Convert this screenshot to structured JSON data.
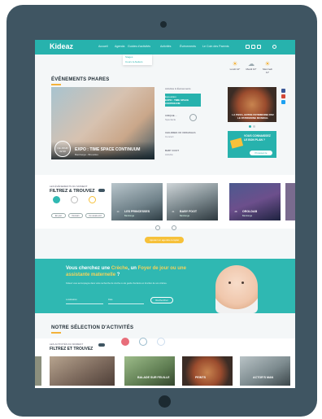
{
  "header": {
    "logo": "Kideaz",
    "nav": [
      {
        "label": "Accueil"
      },
      {
        "label": "Agenda"
      },
      {
        "label": "Guides d'activités"
      },
      {
        "label": "Activités"
      },
      {
        "label": "Événements"
      },
      {
        "label": "Le Coin des Parents"
      }
    ],
    "dropdown": [
      "Stages",
      "Cours & Ateliers"
    ]
  },
  "weather": [
    {
      "day": "Lundi",
      "temp": "12°"
    },
    {
      "day": "Mardi",
      "temp": "10°"
    },
    {
      "day": "Mercredi",
      "temp": "11°"
    }
  ],
  "events": {
    "title": "ÉVÉNEMENTS PHARES",
    "hero": {
      "badge_line1": "CE JOUR",
      "badge_line2": "22:30",
      "title": "EXPO : TIME SPACE CONTINUUM",
      "subtitle": "Bamberga - Bruxelles"
    },
    "list_header": "Activités & Événements",
    "items": [
      {
        "label": "EXPO : TIME SPACE CONTINUUM",
        "sub": "Exposition"
      },
      {
        "label": "CIRQUE ... ",
        "sub": "Spectacle"
      },
      {
        "label": "CHILDREN OF ORIGINALS",
        "sub": "Concert"
      },
      {
        "label": "BABY FOOT",
        "sub": "Activité"
      }
    ],
    "featured_title": "LA PIZZA, ENTRE PATRIMOINE PAR LE PATRIMOINE MONDIAL",
    "newsletter_title": "VOUS CONNAISSEZ LE BON PLAN ?",
    "newsletter_button": "Proposez-le"
  },
  "filter": {
    "kicker": "LES ÉVÉNEMENTS DU MOMENT",
    "title": "FILTREZ & TROUVEZ",
    "pills": [
      "En jour",
      "Demain",
      "Ce week-end"
    ],
    "cards": [
      {
        "date": "14",
        "title": "LES PRINCESSES",
        "sub": "Bamberga"
      },
      {
        "date": "21",
        "title": "BABY FOOT",
        "sub": "Bamberga"
      },
      {
        "date": "28",
        "title": "OROLDAB",
        "sub": "Bamberga"
      }
    ],
    "more_button": "Ajoutez un agenda complet"
  },
  "promo": {
    "heading_pre": "Vous cherchez une ",
    "heading_hl1": "Crèche",
    "heading_mid": ", un ",
    "heading_hl2": "Foyer de jour ou une assistante maternelle",
    "heading_post": " ?",
    "subtitle": "Kideaz vous accompagne dans votre recherche de crèche ou de garde d'enfants en fonction de vos critères.",
    "input1_placeholder": "Localisation",
    "input2_placeholder": "Date",
    "button": "Rechercher"
  },
  "selection": {
    "title": "NOTRE SÉLECTION D'ACTIVITÉS",
    "kicker": "LES ACTIVITÉS DU MOMENT",
    "subtitle": "FILTREZ ET TROUVEZ",
    "cards": [
      {
        "title": "BALADE SUR FEUILLE"
      },
      {
        "title": "PEINTS"
      },
      {
        "title": "ACTOR'S MAN"
      }
    ]
  },
  "colors": {
    "accent": "#27b2ad",
    "yellow": "#f6c13a",
    "dark": "#1e2b33"
  }
}
